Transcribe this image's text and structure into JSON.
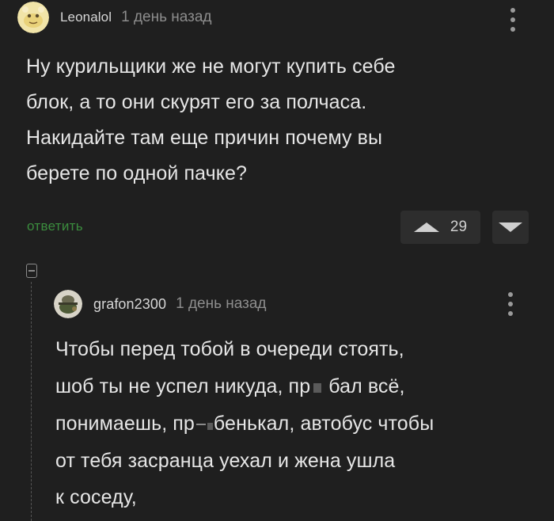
{
  "comment": {
    "username": "Leonalol",
    "timestamp": "1 день назад",
    "body_lines": [
      "Ну курильщики же не могут купить себе",
      "блок, а то они скурят его за полчаса.",
      "Накидайте там еще причин почему вы",
      "берете по одной пачке?"
    ],
    "reply_label": "ответить",
    "rating": "29"
  },
  "reply": {
    "username": "grafon2300",
    "timestamp": "1 день назад",
    "body": {
      "line1": "Чтобы перед тобой в очереди стоять,",
      "line2_a": "шоб ты не успел никуда, пр",
      "line2_b": "бал всё,",
      "line3_a": "понимаешь, пр",
      "line3_b": "бенькал, автобус чтобы",
      "line4": "от тебя засранца уехал и жена ушла",
      "line5": "к соседу,"
    }
  },
  "icons": {
    "avatar_main": "avatar-icon",
    "avatar_reply": "avatar-icon",
    "more": "vertical-dots-icon",
    "vote_up": "triangle-up-icon",
    "vote_down": "triangle-down-icon",
    "collapse": "collapse-minus-icon"
  },
  "colors": {
    "background": "#1f1f1f",
    "reply_link": "#3b8d3e",
    "vote_button_bg": "#2d2d2d"
  }
}
